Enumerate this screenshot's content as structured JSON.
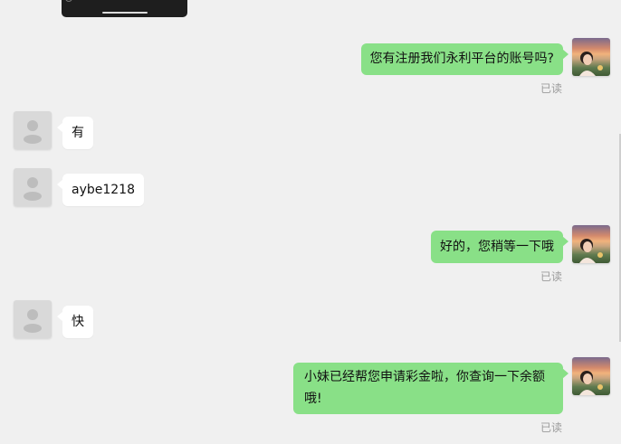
{
  "conversation": {
    "messages": [
      {
        "id": "m1",
        "direction": "outgoing",
        "sender_avatar": "agent-photo-avatar",
        "text": "您有注册我们永利平台的账号吗?",
        "status": "已读"
      },
      {
        "id": "m2",
        "direction": "incoming",
        "sender_avatar": "default-user-avatar",
        "text": "有"
      },
      {
        "id": "m3",
        "direction": "incoming",
        "sender_avatar": "default-user-avatar",
        "text": "aybe1218"
      },
      {
        "id": "m4",
        "direction": "outgoing",
        "sender_avatar": "agent-photo-avatar",
        "text": "好的，您稍等一下哦",
        "status": "已读"
      },
      {
        "id": "m5",
        "direction": "incoming",
        "sender_avatar": "default-user-avatar",
        "text": "快"
      },
      {
        "id": "m6",
        "direction": "outgoing",
        "sender_avatar": "agent-photo-avatar",
        "text": "小妹已经帮您申请彩金啦，你查询一下余额哦!",
        "status": "已读"
      }
    ]
  },
  "colors": {
    "background": "#f0f0f0",
    "outgoing_bubble": "#89e087",
    "incoming_bubble": "#ffffff",
    "read_status": "#9b9b9b"
  }
}
